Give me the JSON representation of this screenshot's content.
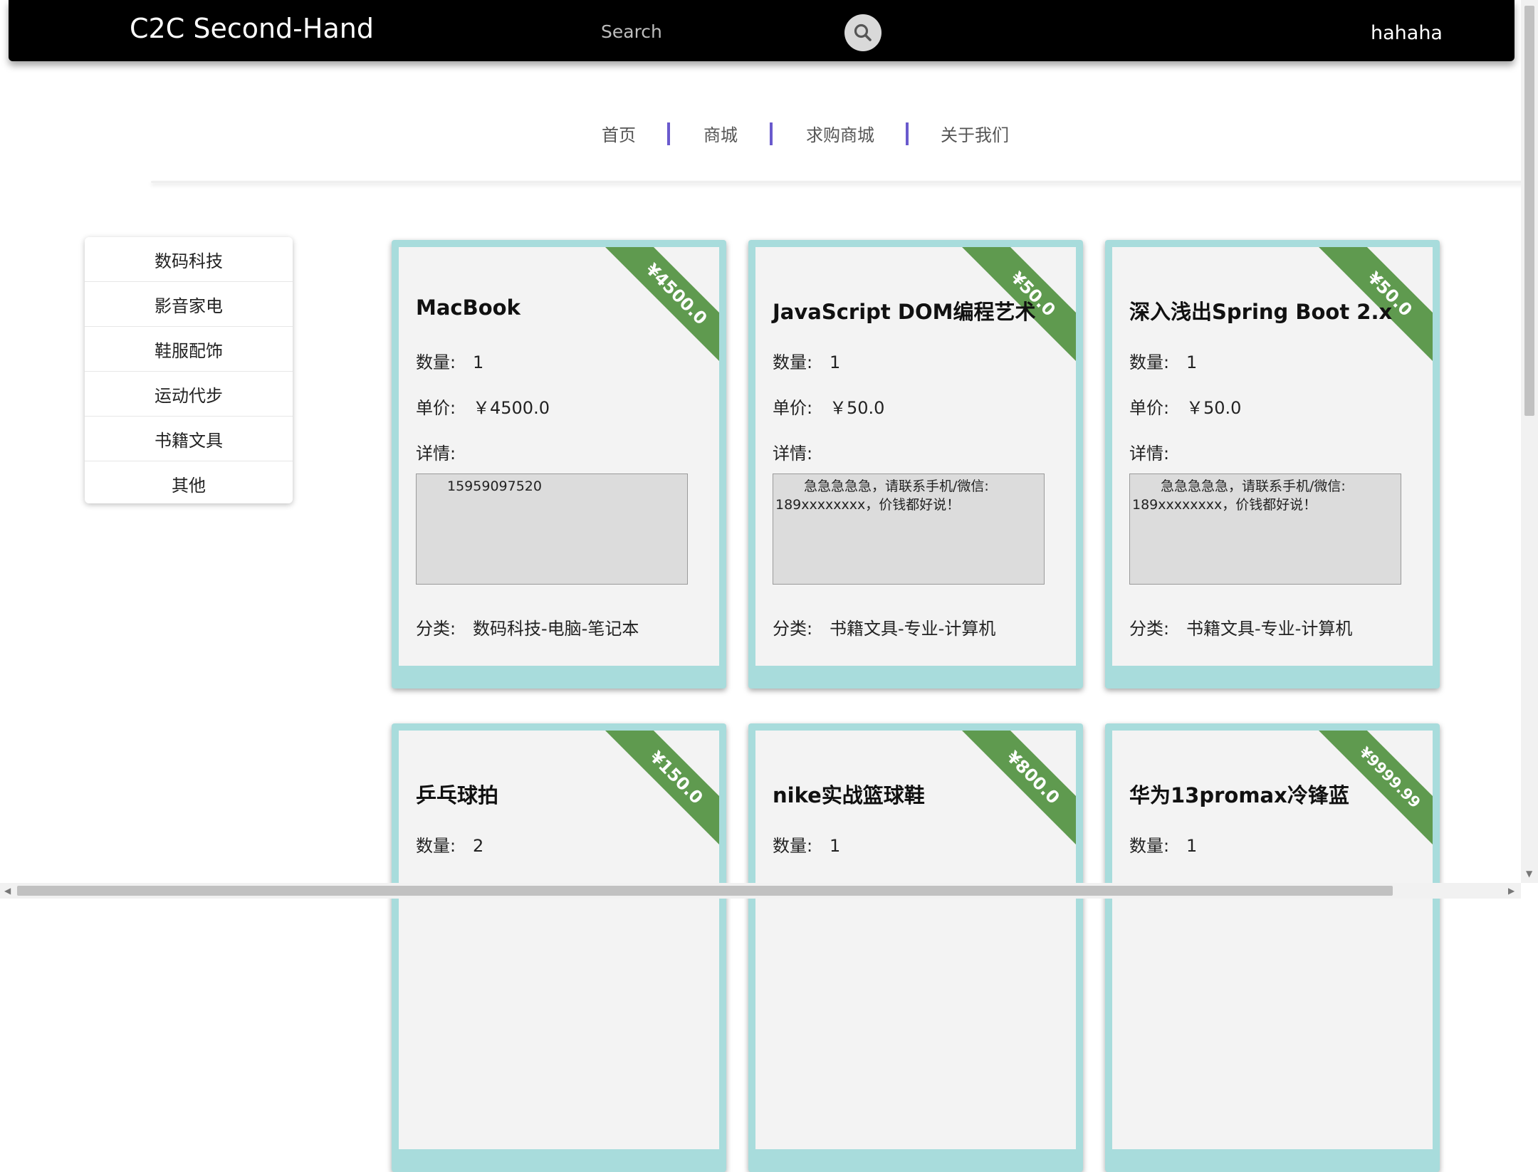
{
  "header": {
    "brand": "C2C Second-Hand",
    "search_placeholder": "Search",
    "search_icon": "search-icon",
    "username": "hahaha"
  },
  "nav": {
    "items": [
      "首页",
      "商城",
      "求购商城",
      "关于我们"
    ]
  },
  "sidebar": {
    "items": [
      "数码科技",
      "影音家电",
      "鞋服配饰",
      "运动代步",
      "书籍文具",
      "其他"
    ]
  },
  "cards": [
    {
      "ribbon": "¥4500.0",
      "title": "MacBook",
      "qty_label": "数量:",
      "qty": "1",
      "price_label": "单价:",
      "price": "￥4500.0",
      "detail_label": "详情:",
      "detail_line1": "15959097520",
      "detail_line2": "",
      "category_label": "分类:",
      "category": "数码科技-电脑-笔记本"
    },
    {
      "ribbon": "¥50.0",
      "title": "JavaScript DOM编程艺术",
      "qty_label": "数量:",
      "qty": "1",
      "price_label": "单价:",
      "price": "￥50.0",
      "detail_label": "详情:",
      "detail_line1": "急急急急急，请联系手机/微信:",
      "detail_line2": "189xxxxxxxx，价钱都好说！",
      "category_label": "分类:",
      "category": "书籍文具-专业-计算机"
    },
    {
      "ribbon": "¥50.0",
      "title": "深入浅出Spring Boot 2.x",
      "qty_label": "数量:",
      "qty": "1",
      "price_label": "单价:",
      "price": "￥50.0",
      "detail_label": "详情:",
      "detail_line1": "急急急急急，请联系手机/微信:",
      "detail_line2": "189xxxxxxxx，价钱都好说！",
      "category_label": "分类:",
      "category": "书籍文具-专业-计算机"
    },
    {
      "ribbon": "¥150.0",
      "title": "乒乓球拍",
      "qty_label": "数量:",
      "qty": "2"
    },
    {
      "ribbon": "¥800.0",
      "title": "nike实战篮球鞋",
      "qty_label": "数量:",
      "qty": "1"
    },
    {
      "ribbon": "¥9999.99",
      "title": "华为13promax冷锋蓝",
      "qty_label": "数量:",
      "qty": "1"
    }
  ],
  "colors": {
    "header_bg": "#000000",
    "card_border": "#a8dcdc",
    "ribbon": "#5f9a4f",
    "nav_separator": "#6a5acd"
  }
}
